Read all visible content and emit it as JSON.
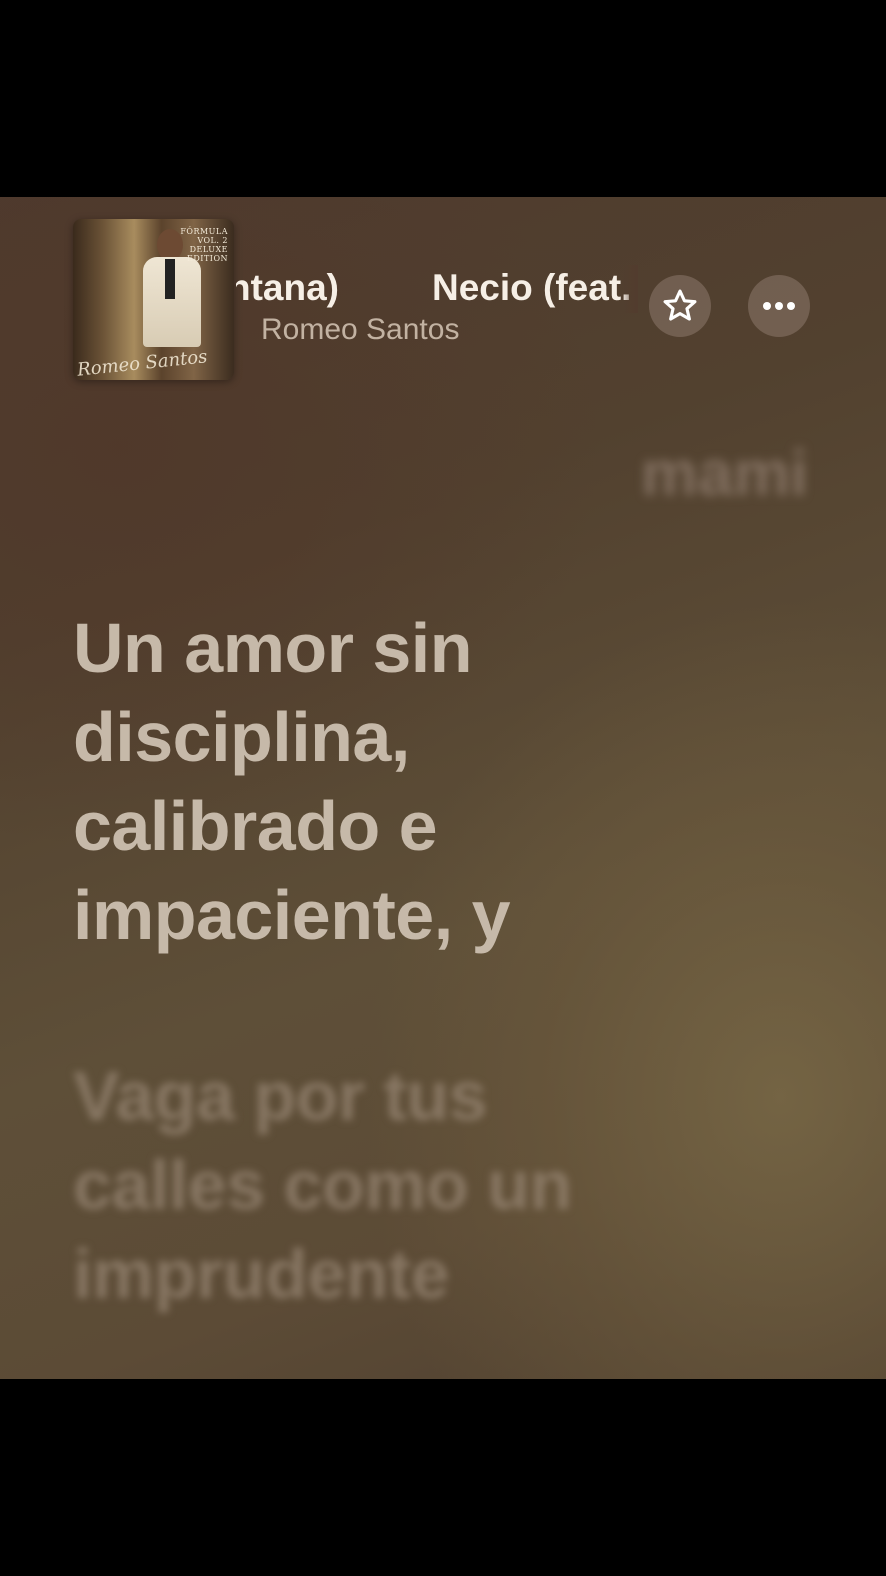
{
  "now_playing": {
    "album_art": {
      "title_text": "FÓRMULA VOL. 2 DELUXE EDITION",
      "artist_script": "Romeo Santos"
    },
    "title_scroll_prev": "ntana)",
    "title_scroll_current": "Necio (feat.",
    "artist": "Romeo Santos"
  },
  "actions": {
    "favorite_icon": "star-icon",
    "more_icon": "ellipsis-icon"
  },
  "lyrics": {
    "previous_line": "mami",
    "current_line": "Un amor sin disciplina, calibrado e impaciente, y",
    "next_line": "Vaga por tus calles como un imprudente"
  },
  "colors": {
    "background_dark": "#4e3a2e",
    "background_light": "#6a5a40",
    "active_lyric": "#c6b9a9",
    "title_text": "#f6efe6"
  }
}
